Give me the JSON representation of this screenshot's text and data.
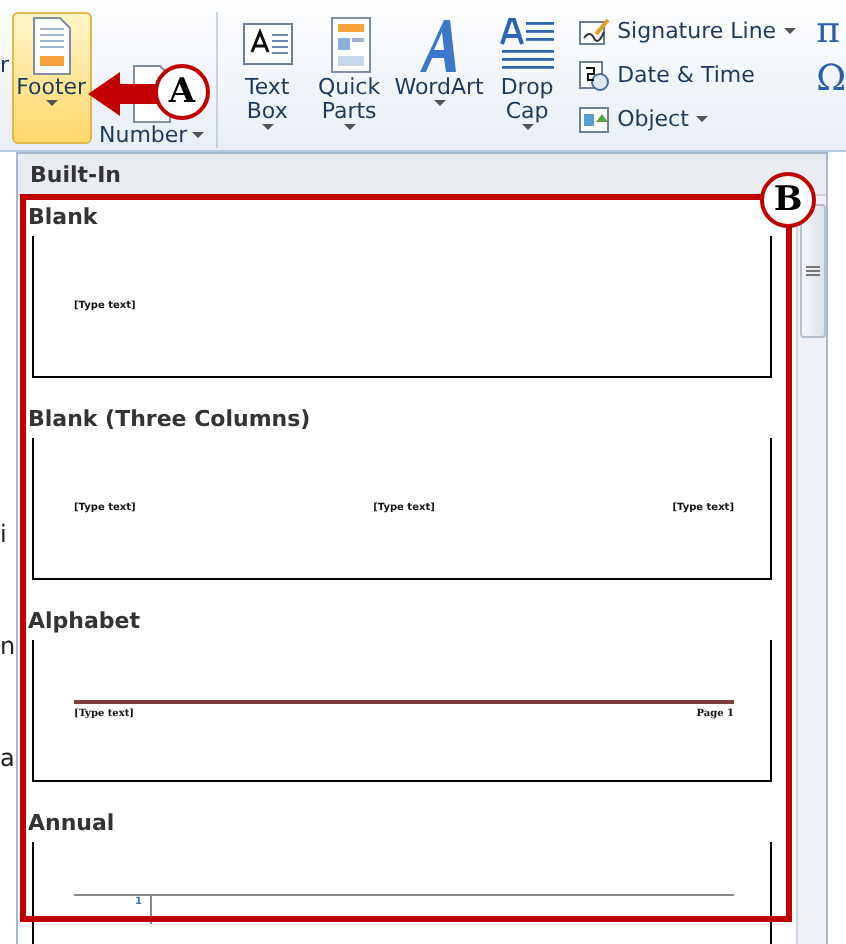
{
  "ribbon": {
    "cut_label": "r",
    "buttons": [
      {
        "kind": "large",
        "lines": [
          "Footer"
        ],
        "selected": true
      },
      {
        "kind": "large",
        "lines": [
          "Number"
        ],
        "selected": false
      },
      {
        "kind": "large",
        "lines": [
          "Text",
          "Box"
        ],
        "selected": false
      },
      {
        "kind": "large",
        "lines": [
          "Quick",
          "Parts"
        ],
        "selected": false
      },
      {
        "kind": "large",
        "lines": [
          "WordArt"
        ],
        "selected": false
      },
      {
        "kind": "large",
        "lines": [
          "Drop",
          "Cap"
        ],
        "selected": false
      }
    ],
    "small_buttons": [
      {
        "label": "Signature Line",
        "dropdown": true
      },
      {
        "label": "Date & Time",
        "dropdown": false
      },
      {
        "label": "Object",
        "dropdown": true
      }
    ],
    "symbols": [
      "π",
      "Ω"
    ]
  },
  "document_fragments": [
    "i",
    "n",
    "a"
  ],
  "gallery": {
    "header": "Built-In",
    "items": [
      {
        "kind": "blank",
        "title": "Blank",
        "texts": [
          "[Type text]"
        ]
      },
      {
        "kind": "three_columns",
        "title": "Blank (Three Columns)",
        "texts": [
          "[Type text]",
          "[Type text]",
          "[Type text]"
        ]
      },
      {
        "kind": "alphabet",
        "title": "Alphabet",
        "texts": [
          "[Type text]",
          "Page 1"
        ]
      },
      {
        "kind": "annual",
        "title": "Annual",
        "texts": [
          "1"
        ]
      }
    ]
  },
  "annotations": [
    {
      "kind": "arrow",
      "letter": "A"
    },
    {
      "kind": "frame",
      "letter": "B"
    }
  ]
}
